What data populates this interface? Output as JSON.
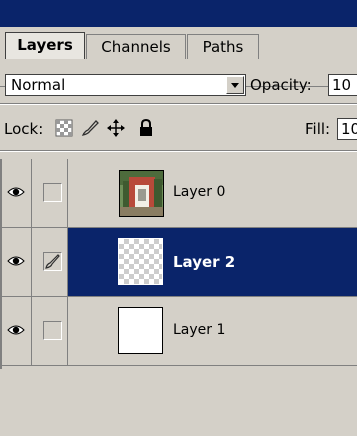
{
  "tabs": [
    {
      "label": "Layers",
      "active": true
    },
    {
      "label": "Channels",
      "active": false
    },
    {
      "label": "Paths",
      "active": false
    }
  ],
  "blend_mode": "Normal",
  "opacity": {
    "label": "Opacity:",
    "value": "10"
  },
  "lock": {
    "label": "Lock:"
  },
  "fill": {
    "label": "Fill:",
    "value": "10"
  },
  "layers": [
    {
      "name": "Layer 0",
      "visible": true,
      "thumbnail": "photo",
      "selected": false,
      "linked_icon": false
    },
    {
      "name": "Layer 2",
      "visible": true,
      "thumbnail": "transparent",
      "selected": true,
      "linked_icon": true
    },
    {
      "name": "Layer 1",
      "visible": true,
      "thumbnail": "white",
      "selected": false,
      "linked_icon": false
    }
  ],
  "colors": {
    "titlebar": "#0a246a",
    "selection": "#0a246a",
    "panel": "#d4d0c8"
  }
}
